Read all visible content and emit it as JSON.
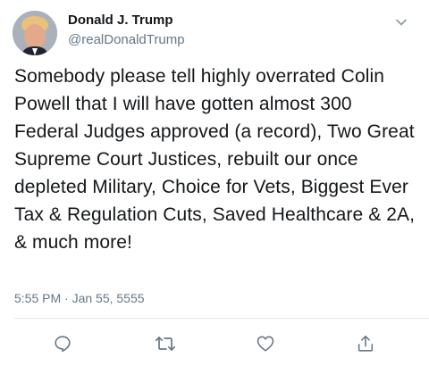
{
  "author": {
    "name": "Donald J. Trump",
    "handle": "@realDonaldTrump"
  },
  "tweet": {
    "text": "Somebody please tell highly overrated Colin Powell that I will have gotten almost 300 Federal Judges approved (a record), Two Great Supreme Court Justices, rebuilt our once depleted Military, Choice for Vets, Biggest Ever Tax & Regulation Cuts, Saved Healthcare & 2A, & much more!",
    "timestamp": "5:55 PM · Jan 55, 5555"
  },
  "icons": {
    "menu": "chevron-down-icon",
    "reply": "reply-icon",
    "retweet": "retweet-icon",
    "like": "heart-icon",
    "share": "share-icon"
  },
  "colors": {
    "text": "#14171a",
    "secondary": "#657786",
    "icon": "#657786"
  }
}
